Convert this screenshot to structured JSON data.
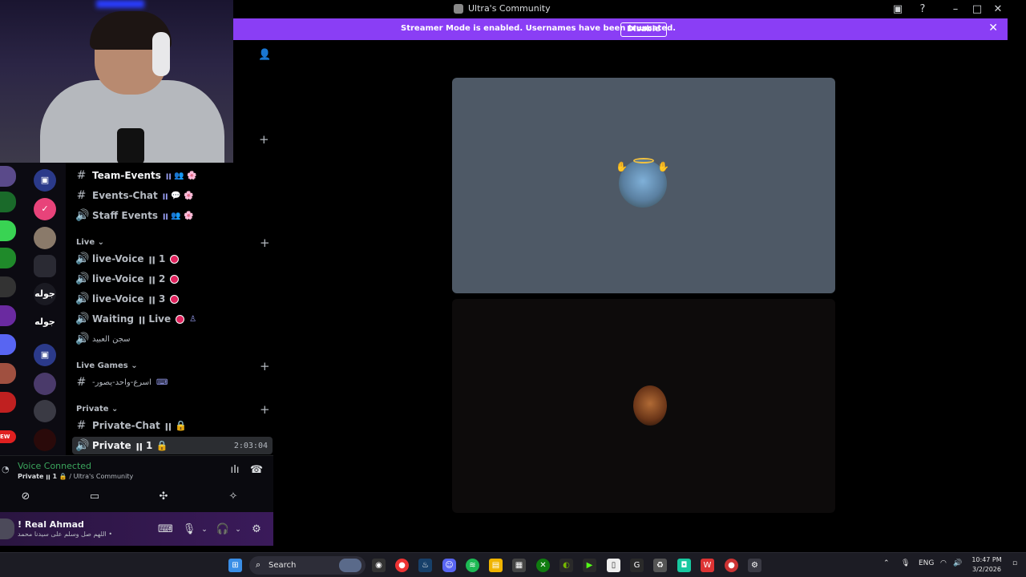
{
  "window": {
    "title": "Ultra's Community"
  },
  "banner": {
    "message": "Streamer Mode is enabled. Usernames have been truncated.",
    "disable_label": "Disable"
  },
  "rail": {
    "items": [
      "",
      "",
      "",
      "",
      "",
      "جوله",
      "جوله",
      "",
      "",
      "EW"
    ]
  },
  "channels": [
    {
      "icon": "#",
      "name": "Team-Events",
      "suffix": "ꞁꞁ 👥 🌸",
      "bright": true
    },
    {
      "icon": "#",
      "name": "Events-Chat",
      "suffix": "ꞁꞁ 💬 🌸"
    },
    {
      "icon": "🔊",
      "name": "Staff Events",
      "suffix": "ꞁꞁ 👥 🌸"
    },
    {
      "icon": "🔊",
      "name": "live-Voice",
      "suffix": "ꞁꞁ 1"
    },
    {
      "icon": "🔊",
      "name": "live-Voice",
      "suffix": "ꞁꞁ 2"
    },
    {
      "icon": "🔊",
      "name": "live-Voice",
      "suffix": "ꞁꞁ 3"
    },
    {
      "icon": "🔊",
      "name": "Waiting",
      "suffix": "ꞁꞁ Live"
    },
    {
      "icon": "🔊",
      "name": "سجن العبيد",
      "suffix": ""
    },
    {
      "icon": "#",
      "name": "-اسرع-واحد-يصور",
      "suffix": "⌨"
    },
    {
      "icon": "#",
      "name": "Private-Chat",
      "suffix": "ꞁꞁ 🔒"
    },
    {
      "icon": "🔊",
      "name": "Private",
      "suffix": "ꞁꞁ 1 🔒",
      "bright": true,
      "time": "2:03:04"
    }
  ],
  "categories": [
    "Live",
    "Live Games",
    "Private"
  ],
  "voice": {
    "status": "Voice Connected",
    "channel": "Private ꞁꞁ 1 🔒",
    "server": "/ Ultra's Community"
  },
  "user": {
    "name": "! Real Ahmad",
    "custom_status": "اللهم صل وسلم على سيدنا محمد •"
  },
  "taskbar": {
    "search_placeholder": "Search",
    "language": "ENG",
    "time": "10:47 PM",
    "date": "3/2/2026"
  },
  "colors": {
    "banner": "#8a3ef5",
    "voice_connected": "#3ba55d",
    "live_dot": "#e0245e",
    "tile_active": "#4e5966"
  }
}
